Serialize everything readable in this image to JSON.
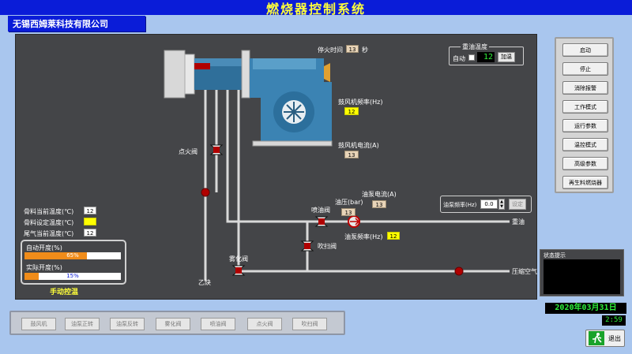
{
  "app": {
    "title": "燃烧器控制系统",
    "company": "无锡西姆莱科技有限公司"
  },
  "burner": {
    "stop_fire_time_label": "停火时间",
    "stop_fire_time_value": "13",
    "stop_fire_time_unit": "秒",
    "fan_freq_label": "鼓风机频率(Hz)",
    "fan_freq_value": "12",
    "fan_current_label": "鼓风机电流(A)",
    "fan_current_value": "13",
    "ignition_valve_label": "点火阀",
    "acetylene_label": "乙炔",
    "atomize_valve_label": "雾化阀",
    "spray_valve_label": "喷油阀",
    "purge_valve_label": "吹扫阀",
    "heavy_oil_label": "重油",
    "compressed_air_label": "压缩空气",
    "oil_pressure_label": "油压(bar)",
    "oil_pressure_value": "13",
    "pump_current_label": "油泵电流(A)",
    "pump_current_value": "13",
    "pump_freq_label": "油泵频率(Hz)",
    "pump_freq_value": "12"
  },
  "heavy_oil_temp": {
    "title": "重油温度",
    "auto_label": "自动",
    "value": "12",
    "heat_button": "加温"
  },
  "pump_set": {
    "label": "油泵频率(Hz)",
    "value": "0.0",
    "set_button": "设定"
  },
  "temps": {
    "current_label": "骨料当前温度(℃)",
    "current_value": "12",
    "set_label": "骨料设定温度(℃)",
    "set_value": "",
    "exhaust_label": "尾气当前温度(℃)",
    "exhaust_value": "12"
  },
  "opening": {
    "auto_label": "自动开度(%)",
    "auto_value": "65%",
    "auto_fraction": 0.65,
    "actual_label": "实际开度(%)",
    "actual_value": "15%",
    "actual_fraction": 0.15,
    "mode_text": "手动控温"
  },
  "right_buttons": [
    "启动",
    "停止",
    "消除报警",
    "工作模式",
    "运行参数",
    "温控模式",
    "高级参数",
    "再生料燃烧器"
  ],
  "bottom_buttons": [
    "鼓风机",
    "油泵正转",
    "油泵反转",
    "雾化阀",
    "喷油阀",
    "点火阀",
    "吹扫阀"
  ],
  "status": {
    "label": "状态提示"
  },
  "datetime": {
    "date": "2020年03月31日",
    "time": "2:59"
  },
  "exit_label": "退出",
  "colors": {
    "title_bar": "#0a1cd8",
    "title_text": "#ffff3a",
    "panel_bg": "#444548",
    "progress_fill": "#f08c1a",
    "valve_red": "#b00000",
    "clock_green": "#2ef23a"
  }
}
